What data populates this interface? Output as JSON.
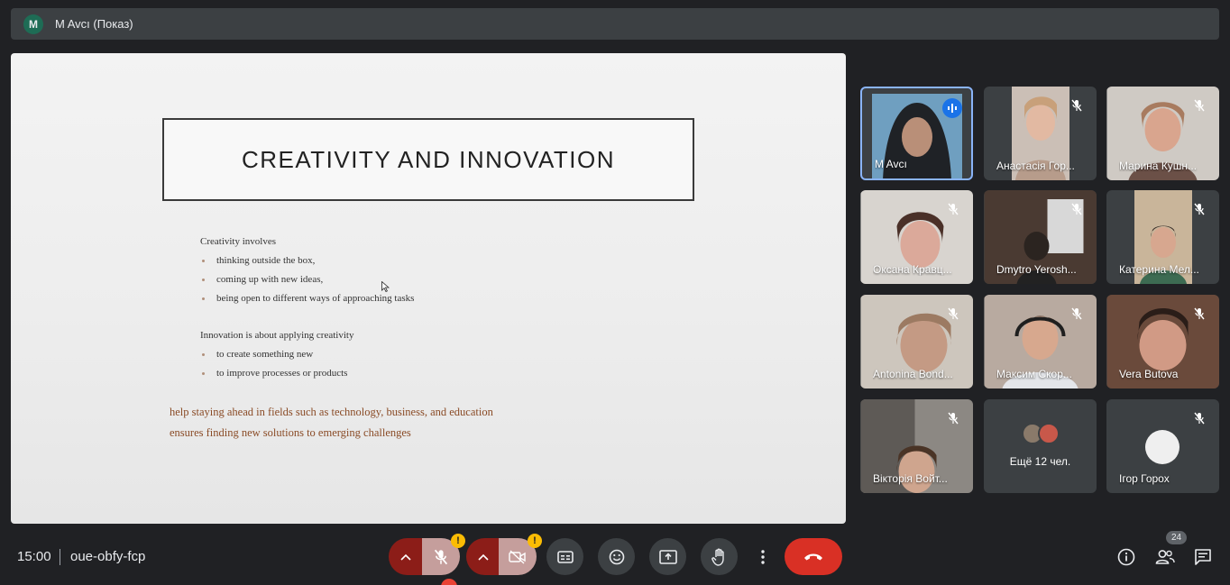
{
  "presenter_bar": {
    "avatar_letter": "M",
    "title": "M Avcı (Показ)"
  },
  "slide": {
    "title": "CREATIVITY AND INNOVATION",
    "section1": {
      "heading": "Creativity involves",
      "bullets": [
        "thinking outside the box,",
        "coming up with new ideas,",
        "being open to different ways of approaching tasks"
      ]
    },
    "section2": {
      "heading": "Innovation is about applying creativity",
      "bullets": [
        "to create something new",
        "to improve processes or products"
      ]
    },
    "notes": [
      "help staying ahead in fields such as technology, business, and education",
      "ensures finding new solutions to emerging challenges"
    ]
  },
  "participants": [
    {
      "name": "M Avcı",
      "status": "speaking",
      "active": true
    },
    {
      "name": "Анастасія Гор...",
      "status": "muted"
    },
    {
      "name": "Марина Кушн...",
      "status": "muted"
    },
    {
      "name": "Оксана Кравц...",
      "status": "muted"
    },
    {
      "name": "Dmytro Yerosh...",
      "status": "muted"
    },
    {
      "name": "Катерина Мел...",
      "status": "muted"
    },
    {
      "name": "Antonina Bond...",
      "status": "muted"
    },
    {
      "name": "Максим Скор...",
      "status": "muted"
    },
    {
      "name": "Vera Butova",
      "status": "muted"
    },
    {
      "name": "Вікторія Войт...",
      "status": "muted"
    },
    {
      "more_label": "Ещё 12 чел."
    },
    {
      "name": "Ігор Горох",
      "status": "muted"
    }
  ],
  "bottom_bar": {
    "time": "15:00",
    "meeting_code": "oue-obfy-fcp",
    "warning_mark": "!",
    "people_count": "24"
  },
  "colors": {
    "background": "#202124",
    "tile": "#3c4043",
    "accent_blue": "#1a73e8",
    "end_call_red": "#d93025",
    "warning_yellow": "#fbbc04",
    "slide_note_text": "#8a4b26"
  },
  "icons": {
    "mic_toggle": "mic-off-icon",
    "camera_toggle": "camera-off-icon",
    "captions": "captions-icon",
    "reactions": "emoji-icon",
    "present": "present-screen-icon",
    "raise_hand": "hand-icon",
    "more": "more-vert-icon",
    "leave": "end-call-icon",
    "info": "info-icon",
    "people": "people-icon",
    "chat": "chat-icon"
  }
}
